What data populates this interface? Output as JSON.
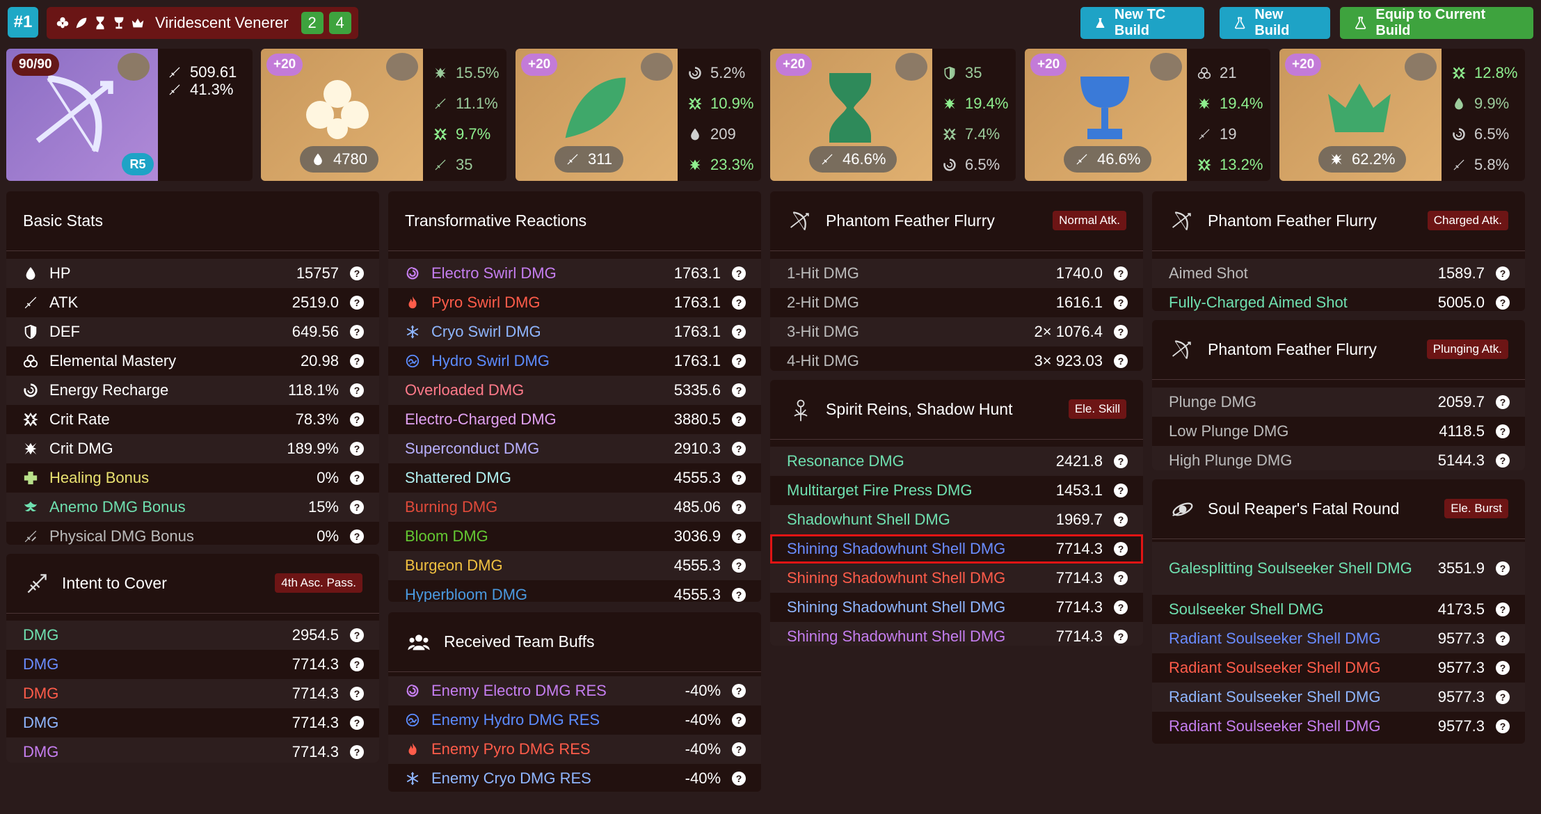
{
  "build": {
    "rank": "#1",
    "set_name": "Viridescent Venerer",
    "set_counts": [
      "2",
      "4"
    ]
  },
  "buttons": {
    "new_tc_build": "New TC Build",
    "new_build": "New Build",
    "equip": "Equip to Current Build"
  },
  "weapon": {
    "level": "90/90",
    "refine": "R5",
    "atk": "509.61",
    "sub": "41.3%"
  },
  "artifacts": [
    {
      "level": "+20",
      "main": "4780",
      "subs": [
        "15.5%",
        "11.1%",
        "9.7%",
        "35"
      ]
    },
    {
      "level": "+20",
      "main": "311",
      "subs": [
        "5.2%",
        "10.9%",
        "209",
        "23.3%"
      ]
    },
    {
      "level": "+20",
      "main": "46.6%",
      "subs": [
        "35",
        "19.4%",
        "7.4%",
        "6.5%"
      ]
    },
    {
      "level": "+20",
      "main": "46.6%",
      "subs": [
        "21",
        "19.4%",
        "19",
        "13.2%"
      ]
    },
    {
      "level": "+20",
      "main": "62.2%",
      "subs": [
        "12.8%",
        "9.9%",
        "6.5%",
        "5.8%"
      ]
    }
  ],
  "basic_stats": {
    "title": "Basic Stats",
    "rows": [
      {
        "label": "HP",
        "value": "15757"
      },
      {
        "label": "ATK",
        "value": "2519.0"
      },
      {
        "label": "DEF",
        "value": "649.56"
      },
      {
        "label": "Elemental Mastery",
        "value": "20.98"
      },
      {
        "label": "Energy Recharge",
        "value": "118.1%"
      },
      {
        "label": "Crit Rate",
        "value": "78.3%"
      },
      {
        "label": "Crit DMG",
        "value": "189.9%"
      },
      {
        "label": "Healing Bonus",
        "value": "0%"
      },
      {
        "label": "Anemo DMG Bonus",
        "value": "15%"
      },
      {
        "label": "Physical DMG Bonus",
        "value": "0%"
      }
    ]
  },
  "intent": {
    "title": "Intent to Cover",
    "tag": "4th Asc. Pass.",
    "rows": [
      {
        "label": "DMG",
        "value": "2954.5"
      },
      {
        "label": "DMG",
        "value": "7714.3"
      },
      {
        "label": "DMG",
        "value": "7714.3"
      },
      {
        "label": "DMG",
        "value": "7714.3"
      },
      {
        "label": "DMG",
        "value": "7714.3"
      }
    ]
  },
  "transformative": {
    "title": "Transformative Reactions",
    "rows": [
      {
        "label": "Electro Swirl DMG",
        "value": "1763.1"
      },
      {
        "label": "Pyro Swirl DMG",
        "value": "1763.1"
      },
      {
        "label": "Cryo Swirl DMG",
        "value": "1763.1"
      },
      {
        "label": "Hydro Swirl DMG",
        "value": "1763.1"
      },
      {
        "label": "Overloaded DMG",
        "value": "5335.6"
      },
      {
        "label": "Electro-Charged DMG",
        "value": "3880.5"
      },
      {
        "label": "Superconduct DMG",
        "value": "2910.3"
      },
      {
        "label": "Shattered DMG",
        "value": "4555.3"
      },
      {
        "label": "Burning DMG",
        "value": "485.06"
      },
      {
        "label": "Bloom DMG",
        "value": "3036.9"
      },
      {
        "label": "Burgeon DMG",
        "value": "4555.3"
      },
      {
        "label": "Hyperbloom DMG",
        "value": "4555.3"
      }
    ]
  },
  "team_buffs": {
    "title": "Received Team Buffs",
    "rows": [
      {
        "label": "Enemy Electro DMG RES",
        "value": "-40%"
      },
      {
        "label": "Enemy Hydro DMG RES",
        "value": "-40%"
      },
      {
        "label": "Enemy Pyro DMG RES",
        "value": "-40%"
      },
      {
        "label": "Enemy Cryo DMG RES",
        "value": "-40%"
      }
    ]
  },
  "normal": {
    "title": "Phantom Feather Flurry",
    "tag": "Normal Atk.",
    "rows": [
      {
        "label": "1-Hit DMG",
        "value": "1740.0"
      },
      {
        "label": "2-Hit DMG",
        "value": "1616.1"
      },
      {
        "label": "3-Hit DMG",
        "value": "2× 1076.4"
      },
      {
        "label": "4-Hit DMG",
        "value": "3× 923.03"
      }
    ]
  },
  "skill": {
    "title": "Spirit Reins, Shadow Hunt",
    "tag": "Ele. Skill",
    "rows": [
      {
        "label": "Resonance DMG",
        "value": "2421.8"
      },
      {
        "label": "Multitarget Fire Press DMG",
        "value": "1453.1"
      },
      {
        "label": "Shadowhunt Shell DMG",
        "value": "1969.7"
      },
      {
        "label": "Shining Shadowhunt Shell DMG",
        "value": "7714.3"
      },
      {
        "label": "Shining Shadowhunt Shell DMG",
        "value": "7714.3"
      },
      {
        "label": "Shining Shadowhunt Shell DMG",
        "value": "7714.3"
      },
      {
        "label": "Shining Shadowhunt Shell DMG",
        "value": "7714.3"
      }
    ]
  },
  "charged": {
    "title": "Phantom Feather Flurry",
    "tag": "Charged Atk.",
    "rows": [
      {
        "label": "Aimed Shot",
        "value": "1589.7"
      },
      {
        "label": "Fully-Charged Aimed Shot",
        "value": "5005.0"
      }
    ]
  },
  "plunging": {
    "title": "Phantom Feather Flurry",
    "tag": "Plunging Atk.",
    "rows": [
      {
        "label": "Plunge DMG",
        "value": "2059.7"
      },
      {
        "label": "Low Plunge DMG",
        "value": "4118.5"
      },
      {
        "label": "High Plunge DMG",
        "value": "5144.3"
      }
    ]
  },
  "burst": {
    "title": "Soul Reaper's Fatal Round",
    "tag": "Ele. Burst",
    "rows": [
      {
        "label": "Galesplitting Soulseeker Shell DMG",
        "value": "3551.9"
      },
      {
        "label": "Soulseeker Shell DMG",
        "value": "4173.5"
      },
      {
        "label": "Radiant Soulseeker Shell DMG",
        "value": "9577.3"
      },
      {
        "label": "Radiant Soulseeker Shell DMG",
        "value": "9577.3"
      },
      {
        "label": "Radiant Soulseeker Shell DMG",
        "value": "9577.3"
      },
      {
        "label": "Radiant Soulseeker Shell DMG",
        "value": "9577.3"
      }
    ]
  },
  "colors": {
    "background": "#2a1b1b",
    "panel": "#22110f",
    "primary_button": "#1ea3c6",
    "success_button": "#3ea33e",
    "tag": "#6d1515",
    "anemo": "#6fe0b0",
    "electro": "#c57ef0",
    "pyro": "#ff5c4a",
    "cryo": "#8fb6ff",
    "hydro": "#5c8cff",
    "dendro": "#64c832",
    "geo": "#f0c040",
    "highlight": "#e01414"
  }
}
